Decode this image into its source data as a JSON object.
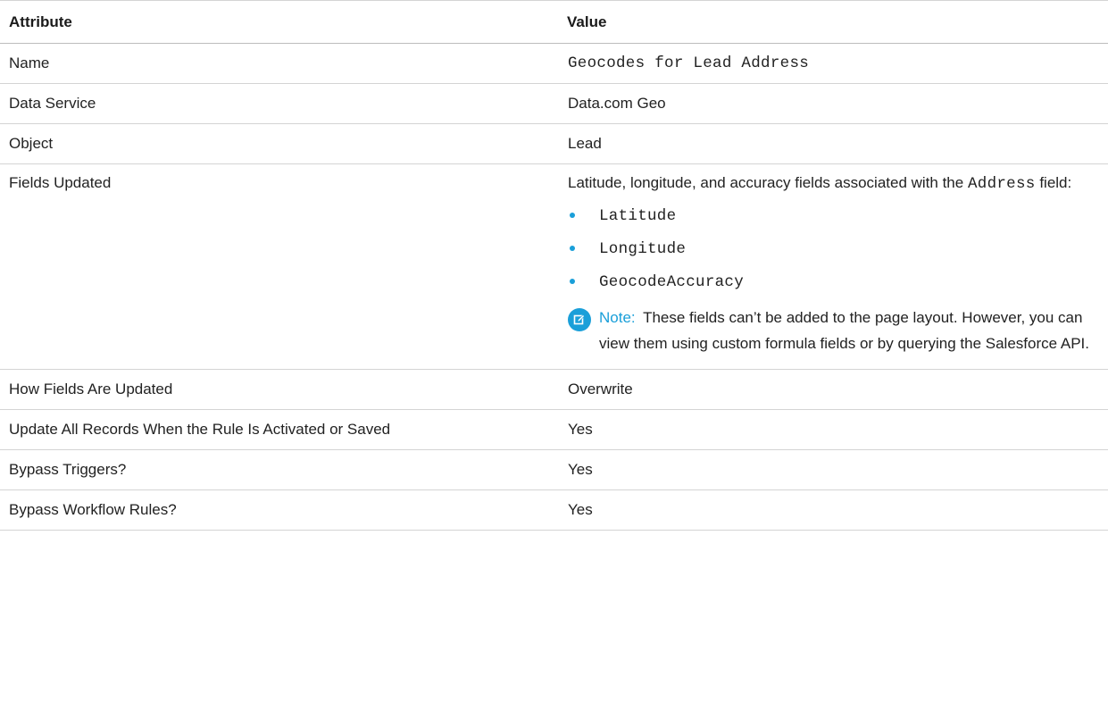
{
  "table": {
    "headers": {
      "attribute": "Attribute",
      "value": "Value"
    },
    "rows": {
      "name": {
        "attribute": "Name",
        "value": "Geocodes for Lead Address"
      },
      "data_service": {
        "attribute": "Data Service",
        "value": "Data.com Geo"
      },
      "object": {
        "attribute": "Object",
        "value": "Lead"
      },
      "fields_updated": {
        "attribute": "Fields Updated",
        "desc_prefix": "Latitude, longitude, and accuracy fields associated with the",
        "desc_code": "Address",
        "desc_suffix": "field:",
        "items": [
          "Latitude",
          "Longitude",
          "GeocodeAccuracy"
        ],
        "note_label": "Note:",
        "note_text": "These fields can’t be added to the page layout. However, you can view them using custom formula fields or by querying the Salesforce API."
      },
      "how_updated": {
        "attribute": "How Fields Are Updated",
        "value": "Overwrite"
      },
      "update_all": {
        "attribute": "Update All Records When the Rule Is Activated or Saved",
        "value": "Yes"
      },
      "bypass_triggers": {
        "attribute": "Bypass Triggers?",
        "value": "Yes"
      },
      "bypass_workflow": {
        "attribute": "Bypass Workflow Rules?",
        "value": "Yes"
      }
    }
  },
  "colors": {
    "accent": "#1a9fd9",
    "border": "#d4d4d4",
    "text": "#222222"
  },
  "icons": {
    "note": "edit-note-icon",
    "bullet": "bullet-dot-icon"
  }
}
